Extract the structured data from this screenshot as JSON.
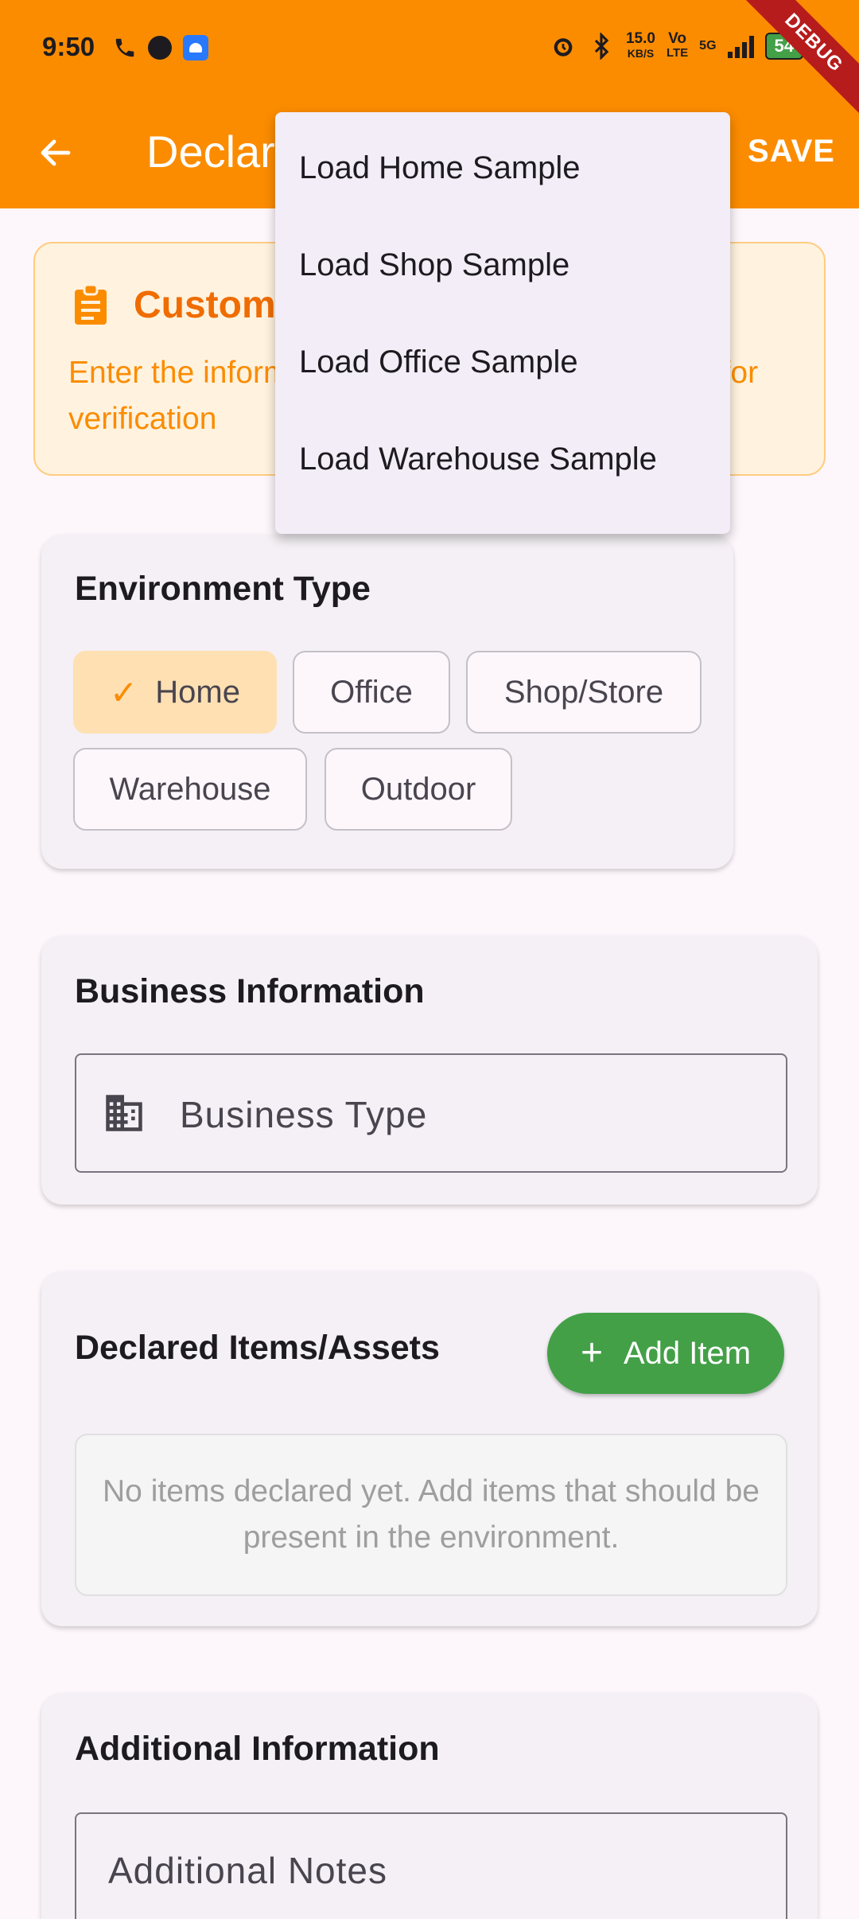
{
  "status_bar": {
    "time": "9:50",
    "net_speed_value": "15.0",
    "net_speed_unit": "KB/S",
    "volte_top": "Vo",
    "volte_bottom": "LTE",
    "network": "5G",
    "battery": "54",
    "debug_banner": "DEBUG"
  },
  "app_bar": {
    "title": "Declared Environment",
    "save_label": "SAVE"
  },
  "menu": {
    "items": [
      {
        "label": "Load Home Sample"
      },
      {
        "label": "Load Shop Sample"
      },
      {
        "label": "Load Office Sample"
      },
      {
        "label": "Load Warehouse Sample"
      }
    ]
  },
  "info_card": {
    "heading": "Customer Declaration",
    "description": "Enter the information declared by the customer for verification"
  },
  "environment": {
    "title": "Environment Type",
    "chips": [
      {
        "label": "Home",
        "selected": true
      },
      {
        "label": "Office",
        "selected": false
      },
      {
        "label": "Shop/Store",
        "selected": false
      },
      {
        "label": "Warehouse",
        "selected": false
      },
      {
        "label": "Outdoor",
        "selected": false
      }
    ]
  },
  "business": {
    "title": "Business Information",
    "field_placeholder": "Business Type"
  },
  "items": {
    "title": "Declared Items/Assets",
    "add_label": "Add Item",
    "empty_text": "No items declared yet. Add items that should be present in the environment."
  },
  "additional": {
    "title": "Additional Information",
    "notes_placeholder": "Additional Notes"
  },
  "colors": {
    "primary": "#fb8c00",
    "accent_green": "#43a047",
    "selected_chip": "#ffe0b2"
  }
}
